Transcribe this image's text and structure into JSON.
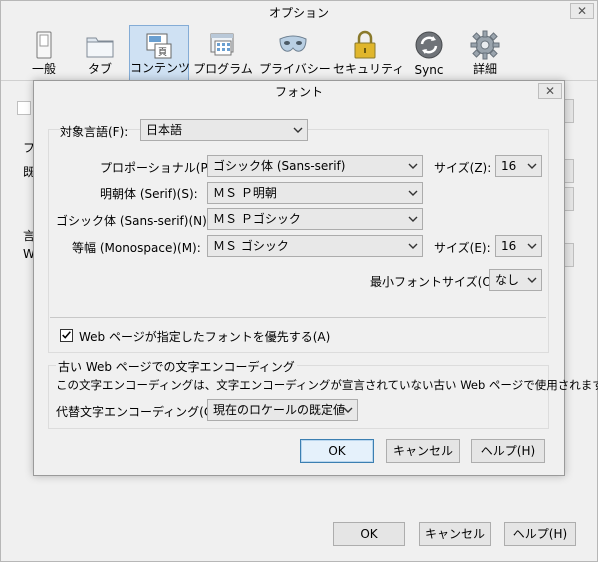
{
  "window": {
    "title": "オプション",
    "close": "✕"
  },
  "toolbar": {
    "items": [
      {
        "label": "一般",
        "icon": "switch-icon"
      },
      {
        "label": "タブ",
        "icon": "folder-tabs-icon"
      },
      {
        "label": "コンテンツ",
        "icon": "page-content-icon",
        "active": true
      },
      {
        "label": "プログラム",
        "icon": "program-icon"
      },
      {
        "label": "プライバシー",
        "icon": "mask-icon"
      },
      {
        "label": "セキュリティ",
        "icon": "lock-icon"
      },
      {
        "label": "Sync",
        "icon": "sync-icon"
      },
      {
        "label": "詳細",
        "icon": "gear-icon"
      }
    ]
  },
  "background": {
    "frag_f": "フ",
    "frag_ki": "既",
    "frag_gen": "言",
    "frag_w": "W"
  },
  "main_buttons": {
    "ok": "OK",
    "cancel": "キャンセル",
    "help": "ヘルプ(H)"
  },
  "dialog": {
    "title": "フォント",
    "close": "✕",
    "target_language": {
      "label": "対象言語(F):",
      "value": "日本語"
    },
    "proportional": {
      "label": "プロポーショナル(P):",
      "value": "ゴシック体 (Sans-serif)",
      "size_label": "サイズ(Z):",
      "size": "16"
    },
    "serif": {
      "label": "明朝体 (Serif)(S):",
      "value": "ＭＳ Ｐ明朝"
    },
    "sans_serif": {
      "label": "ゴシック体 (Sans-serif)(N):",
      "value": "ＭＳ Ｐゴシック"
    },
    "monospace": {
      "label": "等幅 (Monospace)(M):",
      "value": "ＭＳ ゴシック",
      "size_label": "サイズ(E):",
      "size": "16"
    },
    "min_size": {
      "label": "最小フォントサイズ(O):",
      "value": "なし"
    },
    "allow_page_fonts": {
      "label": "Web ページが指定したフォントを優先する(A)",
      "checked": true
    },
    "legacy": {
      "group_label": "古い Web ページでの文字エンコーディング",
      "description": "この文字エンコーディングは、文字エンコーディングが宣言されていない古い Web ページで使用されます。",
      "fallback_label": "代替文字エンコーディング(C):",
      "fallback_value": "現在のロケールの既定値"
    },
    "buttons": {
      "ok": "OK",
      "cancel": "キャンセル",
      "help": "ヘルプ(H)"
    }
  },
  "colors": {
    "active_tab_bg": "#cfe1f3",
    "active_tab_border": "#84acd6",
    "default_button_border": "#3c7fb1"
  }
}
